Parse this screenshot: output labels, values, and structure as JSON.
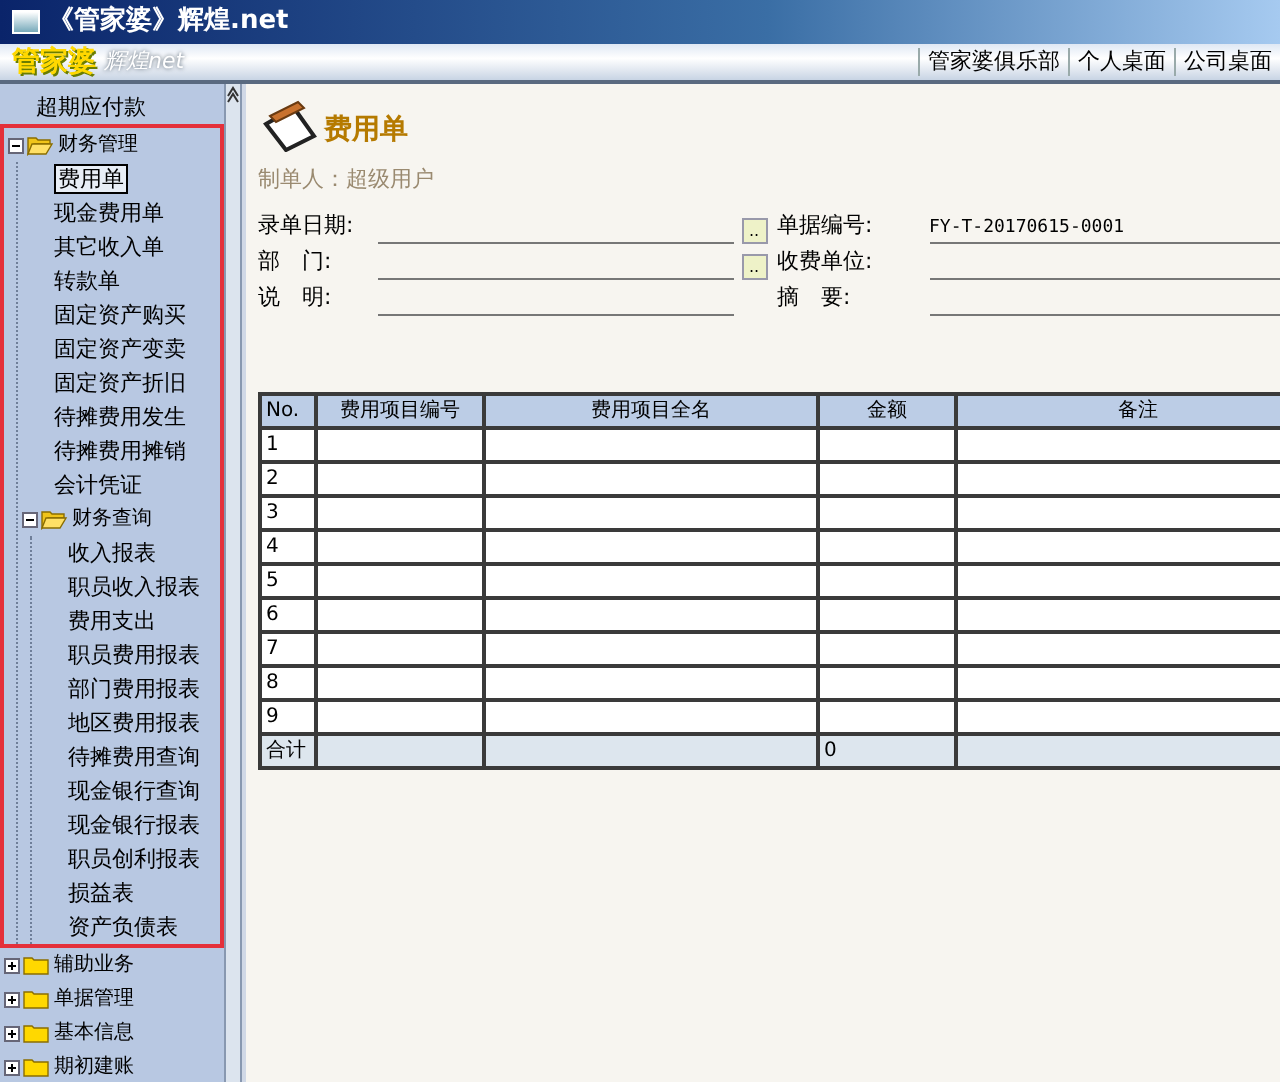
{
  "window": {
    "title": "《管家婆》辉煌.net"
  },
  "header": {
    "logo": "管家婆",
    "logo_sub": "辉煌net",
    "links": [
      "管家婆俱乐部",
      "个人桌面",
      "公司桌面"
    ]
  },
  "sidebar": {
    "tree": [
      {
        "kind": "item",
        "label": "超期应付款",
        "selected": false
      },
      {
        "kind": "folder",
        "label": "财务管理",
        "expanded": true,
        "highlighted": true,
        "children": [
          {
            "kind": "item",
            "label": "费用单",
            "selected": true
          },
          {
            "kind": "item",
            "label": "现金费用单",
            "selected": false
          },
          {
            "kind": "item",
            "label": "其它收入单",
            "selected": false
          },
          {
            "kind": "item",
            "label": "转款单",
            "selected": false
          },
          {
            "kind": "item",
            "label": "固定资产购买",
            "selected": false
          },
          {
            "kind": "item",
            "label": "固定资产变卖",
            "selected": false
          },
          {
            "kind": "item",
            "label": "固定资产折旧",
            "selected": false
          },
          {
            "kind": "item",
            "label": "待摊费用发生",
            "selected": false
          },
          {
            "kind": "item",
            "label": "待摊费用摊销",
            "selected": false
          },
          {
            "kind": "item",
            "label": "会计凭证",
            "selected": false
          },
          {
            "kind": "folder",
            "label": "财务查询",
            "expanded": true,
            "highlighted": false,
            "children": [
              {
                "kind": "item",
                "label": "收入报表",
                "selected": false
              },
              {
                "kind": "item",
                "label": "职员收入报表",
                "selected": false
              },
              {
                "kind": "item",
                "label": "费用支出",
                "selected": false
              },
              {
                "kind": "item",
                "label": "职员费用报表",
                "selected": false
              },
              {
                "kind": "item",
                "label": "部门费用报表",
                "selected": false
              },
              {
                "kind": "item",
                "label": "地区费用报表",
                "selected": false
              },
              {
                "kind": "item",
                "label": "待摊费用查询",
                "selected": false
              },
              {
                "kind": "item",
                "label": "现金银行查询",
                "selected": false
              },
              {
                "kind": "item",
                "label": "现金银行报表",
                "selected": false
              },
              {
                "kind": "item",
                "label": "职员创利报表",
                "selected": false
              },
              {
                "kind": "item",
                "label": "损益表",
                "selected": false
              },
              {
                "kind": "item",
                "label": "资产负债表",
                "selected": false
              }
            ]
          }
        ]
      },
      {
        "kind": "folder",
        "label": "辅助业务",
        "expanded": false,
        "highlighted": false
      },
      {
        "kind": "folder",
        "label": "单据管理",
        "expanded": false,
        "highlighted": false
      },
      {
        "kind": "folder",
        "label": "基本信息",
        "expanded": false,
        "highlighted": false
      },
      {
        "kind": "folder",
        "label": "期初建账",
        "expanded": false,
        "highlighted": false
      }
    ]
  },
  "form": {
    "title": "费用单",
    "creator": "制单人：超级用户",
    "fields": [
      {
        "label": "录单日期:",
        "button": ".."
      },
      {
        "label": "单据编号:",
        "value": "FY-T-20170615-0001"
      },
      {
        "label": "部　门:",
        "button": ".."
      },
      {
        "label": "收费单位:"
      },
      {
        "label": "说　明:"
      },
      {
        "label": "摘　要:"
      }
    ]
  },
  "table": {
    "columns": [
      "No.",
      "费用项目编号",
      "费用项目全名",
      "金额",
      "备注"
    ],
    "rows": [
      [
        "1"
      ],
      [
        "2"
      ],
      [
        "3"
      ],
      [
        "4"
      ],
      [
        "5"
      ],
      [
        "6"
      ],
      [
        "7"
      ],
      [
        "8"
      ],
      [
        "9"
      ]
    ],
    "total": {
      "label": "合计",
      "amount": "0"
    }
  }
}
